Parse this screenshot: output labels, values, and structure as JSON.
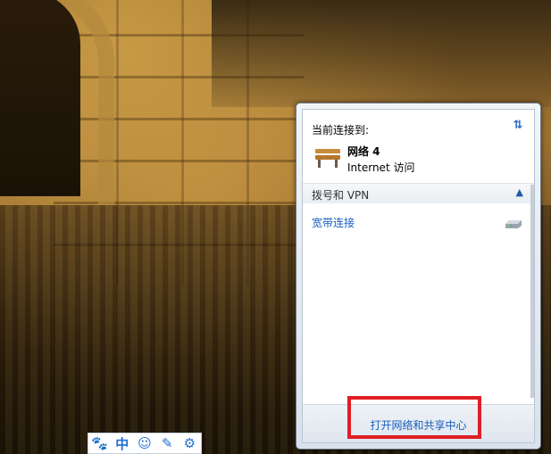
{
  "network_flyout": {
    "current_connection_label": "当前连接到:",
    "network_name": "网络  4",
    "network_access": "Internet 访问",
    "dialup_section_label": "拨号和 VPN",
    "broadband_connection": "宽带连接",
    "open_center_link": "打开网络和共享中心"
  },
  "ime_toolbar": {
    "items": [
      "🐾",
      "中",
      "☺",
      "✎",
      "⚙"
    ]
  },
  "colors": {
    "link": "#1a5fc0",
    "highlight_box": "#e01e24"
  }
}
